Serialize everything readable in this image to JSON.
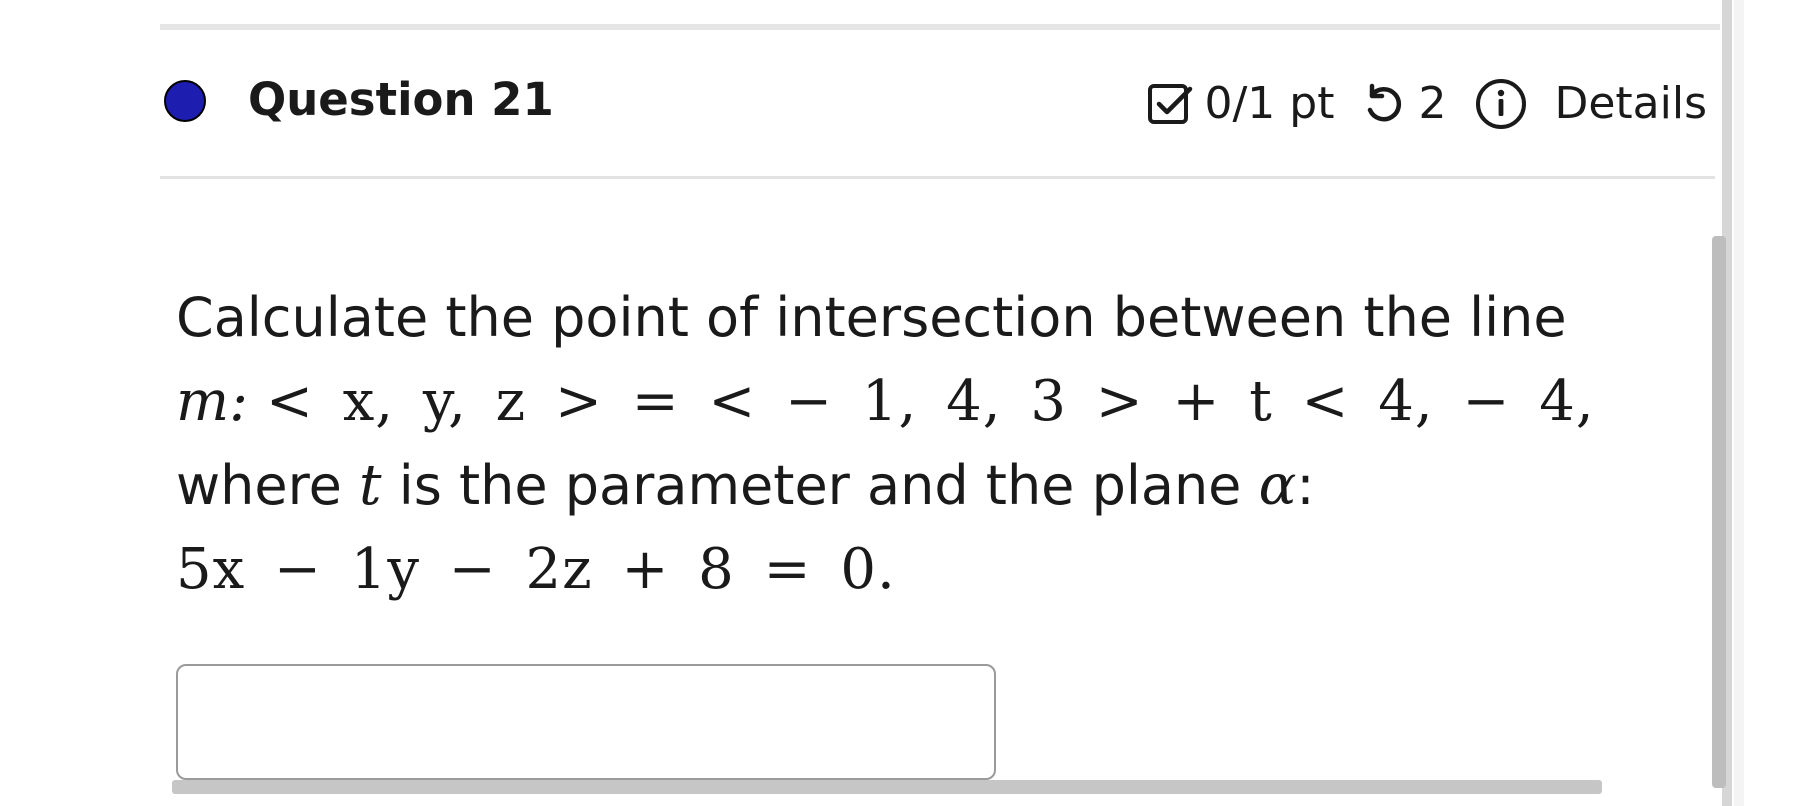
{
  "question": {
    "title": "Question 21",
    "score": "0/1 pt",
    "attempts": "2",
    "details_label": "Details",
    "status_color": "#1d1db0"
  },
  "icons": {
    "score": "checkbox-icon",
    "attempts": "retry-icon",
    "details": "info-icon"
  },
  "body": {
    "line1": "Calculate the point of intersection between the line",
    "line2_label": "m:",
    "line2_math": "< x, y, z > = < − 1, 4, 3 > + t < 4, − 4,",
    "line3_pre": "where ",
    "line3_var": "t",
    "line3_mid": " is the parameter and the plane ",
    "line3_alpha": "α",
    "line3_post": ":",
    "line4_math": "5x − 1y − 2z + 8 = 0."
  },
  "answer": {
    "value": "",
    "placeholder": ""
  }
}
